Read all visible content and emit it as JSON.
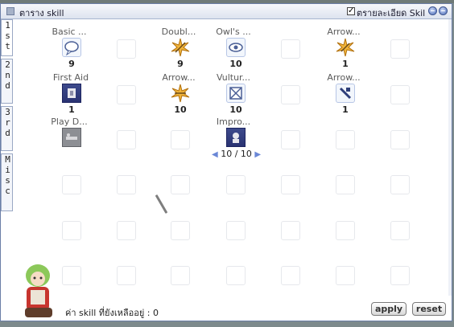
{
  "window": {
    "title": "ตาราง skill",
    "checkbox_label": "ตรายละเอียด Skil",
    "checkbox_checked": true
  },
  "tabs": [
    "1st",
    "2nd",
    "3rd",
    "Misc"
  ],
  "skills": [
    {
      "name": "Basic ...",
      "level": "9",
      "icon": "speech-bubble-icon"
    },
    {
      "name": "Doubl...",
      "level": "9",
      "icon": "starburst-icon"
    },
    {
      "name": "Owl's ...",
      "level": "10",
      "icon": "eye-icon"
    },
    {
      "name": "Arrow...",
      "level": "1",
      "icon": "starburst-icon"
    },
    {
      "name": "First Aid",
      "level": "1",
      "icon": "bandage-icon"
    },
    {
      "name": "Arrow...",
      "level": "10",
      "icon": "starburst-icon"
    },
    {
      "name": "Vultur...",
      "level": "10",
      "icon": "vulture-eye-icon"
    },
    {
      "name": "Arrow...",
      "level": "1",
      "icon": "arrow-crafting-icon"
    },
    {
      "name": "Play D...",
      "level": "",
      "icon": "play-dead-icon"
    },
    {
      "name": "Impro...",
      "level": "",
      "icon": "improve-concentration-icon"
    }
  ],
  "improve_stepper": {
    "current": "10",
    "max": "10",
    "separator": "/"
  },
  "footer": {
    "points_label": "ค่า skill ที่ยังเหลืออยู่ : 0",
    "apply_label": "apply",
    "reset_label": "reset"
  },
  "colors": {
    "title_bg": "#dde3ef",
    "accent": "#4f6fb9",
    "slot_border": "#e6e8ec"
  }
}
